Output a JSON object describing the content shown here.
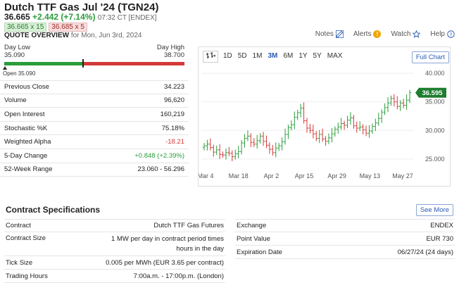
{
  "header": {
    "title": "Dutch TTF Gas Jul '24 (TGN24)",
    "last": "36.665",
    "change": "+2.442 (+7.14%)",
    "time": "07:32 CT [ENDEX]",
    "bid": "36.665 x 15",
    "ask": "36.685 x 5",
    "quote_overview": "QUOTE OVERVIEW",
    "quote_date": "for Mon, Jun 3rd, 2024"
  },
  "toplinks": {
    "notes": "Notes",
    "alerts": "Alerts",
    "alerts_badge": "!",
    "watch": "Watch",
    "help": "Help"
  },
  "day_range": {
    "low_label": "Day Low",
    "low_value": "35.090",
    "high_label": "Day High",
    "high_value": "38.700",
    "open_label": "Open 35.090",
    "current_fraction": 0.44
  },
  "stats": [
    {
      "label": "Previous Close",
      "value": "34.223",
      "tone": ""
    },
    {
      "label": "Volume",
      "value": "96,620",
      "tone": ""
    },
    {
      "label": "Open Interest",
      "value": "160,219",
      "tone": ""
    },
    {
      "label": "Stochastic %K",
      "value": "75.18%",
      "tone": ""
    },
    {
      "label": "Weighted Alpha",
      "value": "-18.21",
      "tone": "neg"
    },
    {
      "label": "5-Day Change",
      "value": "+0.848 (+2.39%)",
      "tone": "pos"
    },
    {
      "label": "52-Week Range",
      "value": "23.060 - 56.296",
      "tone": ""
    }
  ],
  "chart_toolbar": {
    "periods": [
      "1D",
      "5D",
      "1M",
      "3M",
      "6M",
      "1Y",
      "5Y",
      "MAX"
    ],
    "active": "3M",
    "full_chart": "Full Chart"
  },
  "chart_data": {
    "type": "ohlc",
    "x_labels": [
      "Mar 4",
      "Mar 18",
      "Apr 2",
      "Apr 15",
      "Apr 29",
      "May 13",
      "May 27"
    ],
    "y_ticks": [
      25,
      30,
      35,
      40
    ],
    "y_tick_labels": [
      "25.000",
      "30.000",
      "35.000",
      "40.000"
    ],
    "ylim": [
      23.5,
      41
    ],
    "last_price_label": "36.595",
    "last_price": 36.595,
    "close": [
      27.3,
      27.6,
      27.0,
      26.2,
      26.6,
      25.8,
      25.7,
      26.1,
      26.0,
      25.4,
      25.9,
      26.3,
      27.8,
      28.6,
      29.0,
      27.9,
      27.6,
      28.2,
      29.0,
      28.1,
      27.4,
      26.7,
      26.1,
      26.9,
      27.3,
      28.0,
      29.3,
      30.5,
      31.0,
      32.3,
      33.1,
      33.9,
      31.7,
      30.4,
      30.0,
      29.4,
      28.6,
      29.3,
      28.5,
      28.1,
      28.7,
      29.4,
      30.2,
      30.6,
      31.2,
      30.9,
      31.8,
      32.2,
      30.8,
      30.4,
      30.6,
      30.1,
      29.5,
      29.9,
      30.7,
      31.3,
      32.1,
      33.2,
      34.0,
      34.8,
      35.6,
      35.0,
      34.2,
      34.8,
      34.4,
      35.3,
      36.6
    ]
  },
  "specs": {
    "title": "Contract Specifications",
    "see_more": "See More",
    "left": [
      {
        "label": "Contract",
        "value": "Dutch TTF Gas Futures"
      },
      {
        "label": "Contract Size",
        "value": "1 MW per day in contract period times hours in the day"
      },
      {
        "label": "Tick Size",
        "value": "0.005 per MWh (EUR 3.65 per contract)"
      },
      {
        "label": "Trading Hours",
        "value": "7:00a.m. - 17:00p.m. (London)"
      }
    ],
    "right": [
      {
        "label": "Exchange",
        "value": "ENDEX"
      },
      {
        "label": "Point Value",
        "value": "EUR 730"
      },
      {
        "label": "Expiration Date",
        "value": "06/27/24 (24 days)"
      }
    ]
  }
}
